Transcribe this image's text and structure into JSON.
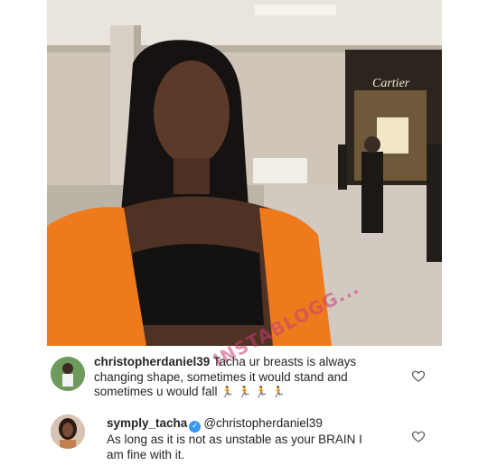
{
  "photo": {
    "store_sign": "Cartier",
    "watermark": "INSTABLOGG..."
  },
  "comments": [
    {
      "username": "christopherdaniel39",
      "text": " Tacha ur breasts is always changing shape, sometimes it would stand and sometimes u would fall ",
      "emoji": "🏃 🏃 🏃 🏃",
      "avatar_icon": "user-avatar-football-player"
    },
    {
      "username": "symply_tacha",
      "verified_icon": "verified-badge-icon",
      "mention": "@christopherdaniel39",
      "text": "As long as it is not as unstable as your BRAIN I am fine with it.",
      "avatar_icon": "user-avatar-woman"
    }
  ]
}
